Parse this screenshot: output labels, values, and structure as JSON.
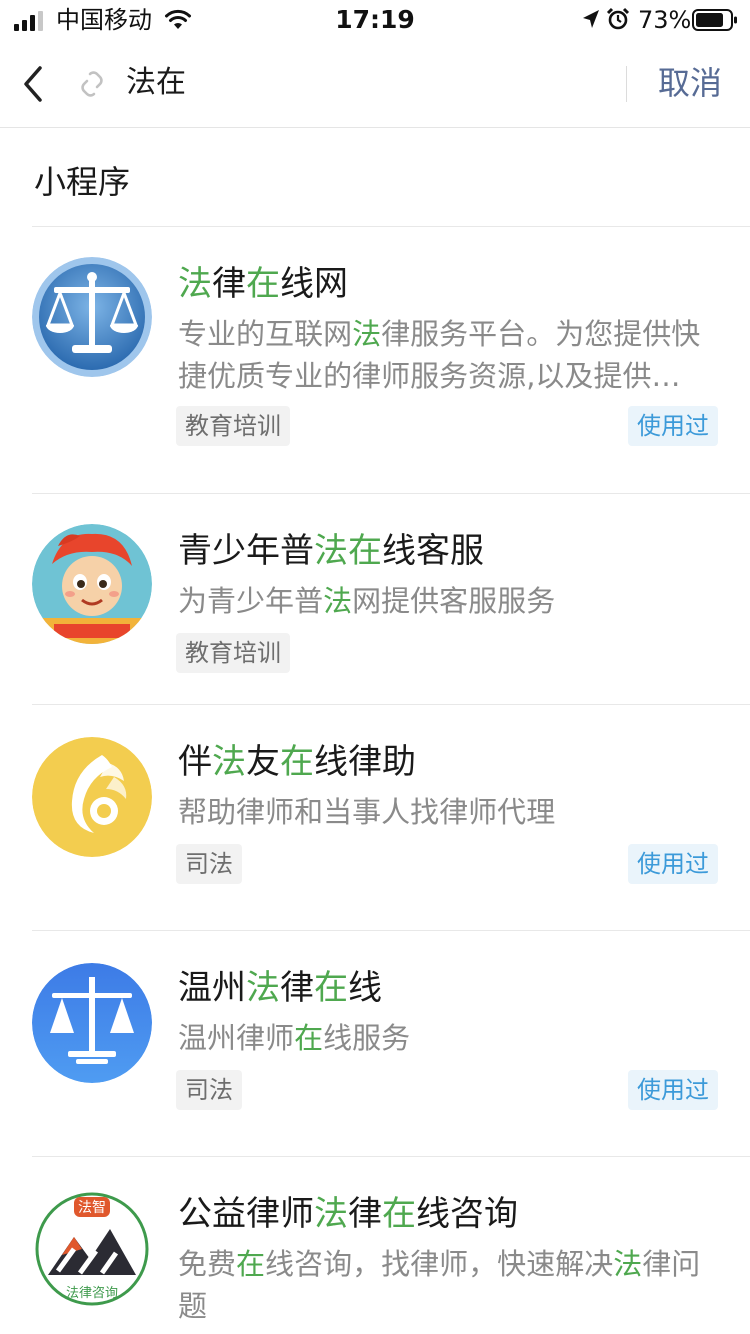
{
  "status_bar": {
    "carrier": "中国移动",
    "time": "17:19",
    "battery": "73%",
    "icons": [
      "signal-icon",
      "wifi-icon",
      "location-icon",
      "alarm-icon",
      "battery-icon"
    ]
  },
  "header": {
    "query": "法在",
    "cancel_label": "取消",
    "icons": [
      "back-arrow-icon",
      "link-icon"
    ]
  },
  "section": {
    "title": "小程序"
  },
  "colors": {
    "highlight": "#4fa84f",
    "cancel": "#576b95",
    "used_badge_text": "#3c9ad9",
    "used_badge_bg": "#eaf4fb"
  },
  "results": [
    {
      "title": "法律在线网",
      "description": "专业的互联网法律服务平台。为您提供快捷优质专业的律师服务资源,以及提供…",
      "tag": "教育培训",
      "used": "使用过",
      "icon": "scales-logo-icon"
    },
    {
      "title": "青少年普法在线客服",
      "description": "为青少年普法网提供客服服务",
      "tag": "教育培训",
      "used": "",
      "icon": "cartoon-mascot-icon"
    },
    {
      "title": "伴法友在线律助",
      "description": "帮助律师和当事人找律师代理",
      "tag": "司法",
      "used": "使用过",
      "icon": "yellow-swirl-logo-icon"
    },
    {
      "title": "温州法律在线",
      "description": "温州律师在线服务",
      "tag": "司法",
      "used": "使用过",
      "icon": "blue-scales-logo-icon"
    },
    {
      "title": "公益律师法律在线咨询",
      "description": "免费在线咨询，找律师，快速解决法律问题",
      "tag": "",
      "used": "",
      "icon": "mountain-seal-logo-icon",
      "logo_text_top": "法智",
      "logo_text_bottom": "法律咨询"
    }
  ]
}
